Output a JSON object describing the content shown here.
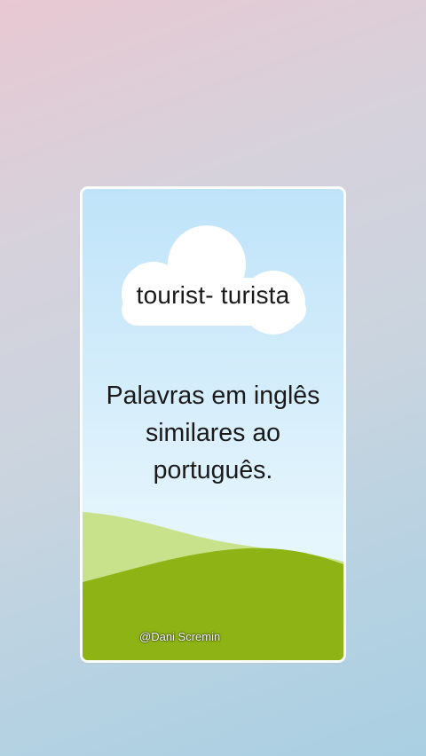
{
  "card": {
    "title": "tourist- turista",
    "body_lines": [
      "Palavras em inglês",
      "similares ao",
      "português."
    ],
    "author": "@Dani Scremin"
  },
  "colors": {
    "sky_top": "#bfe3f9",
    "sky_bottom": "#e9f8fc",
    "cloud": "#ffffff",
    "hill_light": "#c8e28c",
    "hill_dark": "#8db314"
  },
  "icons": {
    "cloud": "cloud-illustration",
    "hills": "hills-illustration"
  }
}
